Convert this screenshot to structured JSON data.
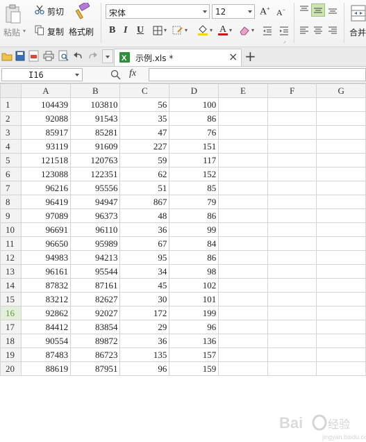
{
  "ribbon": {
    "paste_label": "粘贴",
    "cut_label": "剪切",
    "copy_label": "复制",
    "format_painter_label": "格式刷",
    "font_name": "宋体",
    "font_size": "12",
    "bold_label": "B",
    "italic_label": "I",
    "underline_label": "U",
    "merge_label": "合并"
  },
  "tabs": {
    "file_tab_label": "示例.xls *",
    "close_label": "×",
    "new_tab_label": "+"
  },
  "formula_bar": {
    "name_box": "I16",
    "fx_label": "fx",
    "formula_value": ""
  },
  "sheet": {
    "columns": [
      "A",
      "B",
      "C",
      "D",
      "E",
      "F",
      "G"
    ],
    "rows": [
      {
        "n": "1",
        "a": "104439",
        "b": "103810",
        "c": "56",
        "d": "100"
      },
      {
        "n": "2",
        "a": "92088",
        "b": "91543",
        "c": "35",
        "d": "86"
      },
      {
        "n": "3",
        "a": "85917",
        "b": "85281",
        "c": "47",
        "d": "76"
      },
      {
        "n": "4",
        "a": "93119",
        "b": "91609",
        "c": "227",
        "d": "151"
      },
      {
        "n": "5",
        "a": "121518",
        "b": "120763",
        "c": "59",
        "d": "117"
      },
      {
        "n": "6",
        "a": "123088",
        "b": "122351",
        "c": "62",
        "d": "152"
      },
      {
        "n": "7",
        "a": "96216",
        "b": "95556",
        "c": "51",
        "d": "85"
      },
      {
        "n": "8",
        "a": "96419",
        "b": "94947",
        "c": "867",
        "d": "79"
      },
      {
        "n": "9",
        "a": "97089",
        "b": "96373",
        "c": "48",
        "d": "86"
      },
      {
        "n": "10",
        "a": "96691",
        "b": "96110",
        "c": "36",
        "d": "99"
      },
      {
        "n": "11",
        "a": "96650",
        "b": "95989",
        "c": "67",
        "d": "84"
      },
      {
        "n": "12",
        "a": "94983",
        "b": "94213",
        "c": "95",
        "d": "86"
      },
      {
        "n": "13",
        "a": "96161",
        "b": "95544",
        "c": "34",
        "d": "98"
      },
      {
        "n": "14",
        "a": "87832",
        "b": "87161",
        "c": "45",
        "d": "102"
      },
      {
        "n": "15",
        "a": "83212",
        "b": "82627",
        "c": "30",
        "d": "101"
      },
      {
        "n": "16",
        "a": "92862",
        "b": "92027",
        "c": "172",
        "d": "199"
      },
      {
        "n": "17",
        "a": "84412",
        "b": "83854",
        "c": "29",
        "d": "96"
      },
      {
        "n": "18",
        "a": "90554",
        "b": "89872",
        "c": "36",
        "d": "136"
      },
      {
        "n": "19",
        "a": "87483",
        "b": "86723",
        "c": "135",
        "d": "157"
      },
      {
        "n": "20",
        "a": "88619",
        "b": "87951",
        "c": "96",
        "d": "159"
      }
    ]
  },
  "colors": {
    "active_row_header": "#5c9c32",
    "grid_line": "#d4d4d4",
    "excel_icon": "#2f8f3a"
  }
}
